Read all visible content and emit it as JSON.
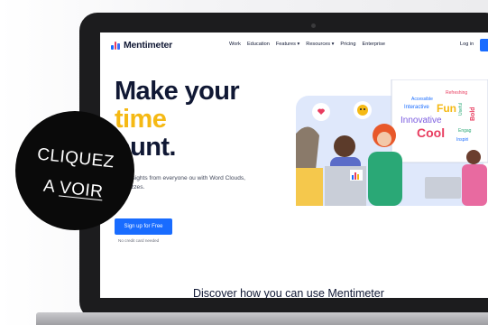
{
  "app": {
    "name": "Mentimeter"
  },
  "nav": {
    "links": [
      "Work",
      "Education",
      "Features ▾",
      "Resources ▾",
      "Pricing",
      "Enterprise"
    ],
    "login": "Log in"
  },
  "hero": {
    "title_line1": "Make your",
    "title_line2": "time",
    "title_line3": "ount.",
    "subtitle": "able insights from everyone ou with Word Clouds, Polls, zzes.",
    "cta_label": "Sign up for Free",
    "no_card_note": "No credit card needed"
  },
  "illustration": {
    "words": [
      "Refreshing",
      "Accessible",
      "Interactive",
      "Fun",
      "Innovative",
      "Bold",
      "Cool",
      "Engag",
      "Inspiri",
      "Useful"
    ]
  },
  "section": {
    "discover_heading": "Discover how you can use Mentimeter"
  },
  "overlay": {
    "line1": "CLIQUEZ",
    "line2_prefix": "A ",
    "line2_link": "VOIR"
  },
  "colors": {
    "accent_blue": "#196cff",
    "title_navy": "#101834",
    "title_yellow": "#f5b914",
    "overlay_black": "#0a0a0a"
  }
}
